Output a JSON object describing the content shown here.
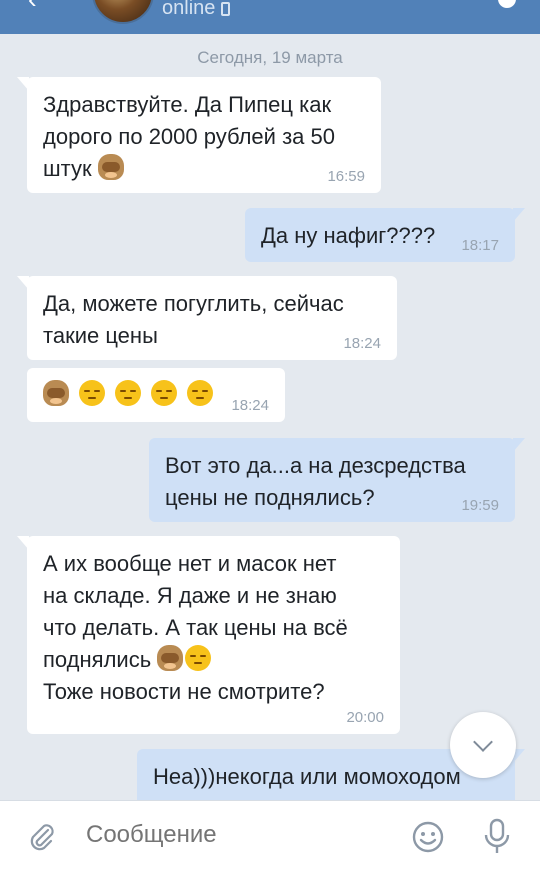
{
  "header": {
    "status": "online"
  },
  "chat": {
    "date_label": "Сегодня, 19 марта",
    "messages": [
      {
        "direction": "in",
        "text_lines": [
          "Здравствуйте. Да Пипец как",
          "дорого по 2000 рублей за 50",
          "штук"
        ],
        "emoji_after": [
          "monkey"
        ],
        "time": "16:59"
      },
      {
        "direction": "out",
        "text_lines": [
          "Да ну нафиг????"
        ],
        "time": "18:17"
      },
      {
        "direction": "in",
        "text_lines": [
          "Да, можете погуглить, сейчас",
          "такие цены"
        ],
        "time": "18:24"
      },
      {
        "direction": "in",
        "emoji_only": [
          "monkey",
          "pensive",
          "pensive",
          "pensive",
          "pensive"
        ],
        "time": "18:24"
      },
      {
        "direction": "out",
        "text_lines": [
          "Вот это да...а на дезсредства",
          "цены не поднялись?"
        ],
        "time": "19:59"
      },
      {
        "direction": "in",
        "text_lines": [
          "А их вообще нет и масок нет",
          "на складе. Я даже и не знаю",
          "что делать. А так цены на всё",
          "поднялись",
          "Тоже новости не смотрите?"
        ],
        "time": "20:00"
      },
      {
        "direction": "out",
        "text_lines": [
          "Неа)))некогда или момоходом"
        ]
      }
    ]
  },
  "composer": {
    "placeholder": "Сообщение"
  },
  "icons": {
    "attach": "paperclip-icon",
    "emoji": "smile-icon",
    "mic": "microphone-icon",
    "scroll": "chevron-down-icon"
  },
  "colors": {
    "header": "#5181b8",
    "background": "#e4e9ef",
    "incoming": "#ffffff",
    "outgoing": "#cfe0f6"
  }
}
